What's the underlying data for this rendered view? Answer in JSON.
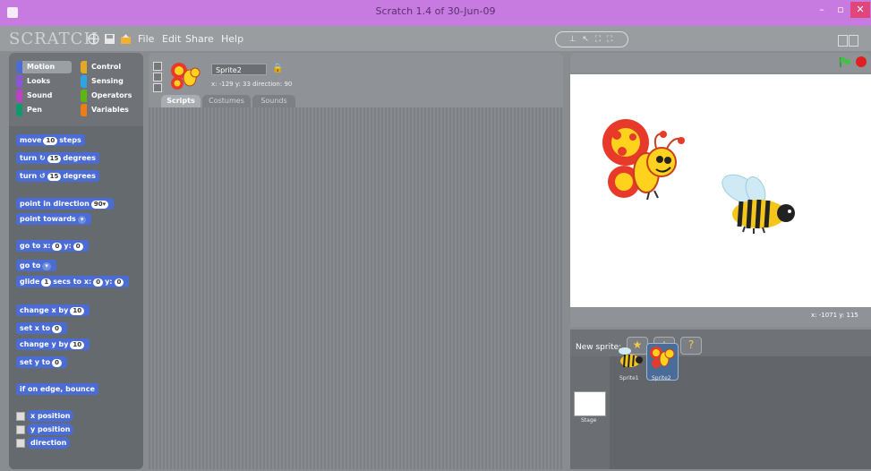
{
  "window": {
    "title": "Scratch 1.4 of 30-Jun-09",
    "controls": [
      "–",
      "▫",
      "✕"
    ]
  },
  "menubar": {
    "logo": "SCRATCH",
    "menus": [
      "File",
      "Edit",
      "Share",
      "Help"
    ],
    "mode_buttons": "⊥ ↖ ⛶ ⛶"
  },
  "categories": [
    {
      "label": "Motion",
      "color": "#4a6cd4",
      "selected": true
    },
    {
      "label": "Control",
      "color": "#e6a822"
    },
    {
      "label": "Looks",
      "color": "#8a55d7"
    },
    {
      "label": "Sensing",
      "color": "#2ca5e2"
    },
    {
      "label": "Sound",
      "color": "#bb42c3"
    },
    {
      "label": "Operators",
      "color": "#5cb712"
    },
    {
      "label": "Pen",
      "color": "#0e9a6c"
    },
    {
      "label": "Variables",
      "color": "#ee7d16"
    }
  ],
  "blocks": {
    "move": {
      "text": "move",
      "val": "10",
      "suffix": "steps"
    },
    "turn_cw": {
      "text": "turn ↻",
      "val": "15",
      "suffix": "degrees"
    },
    "turn_ccw": {
      "text": "turn ↺",
      "val": "15",
      "suffix": "degrees"
    },
    "point_dir": {
      "text": "point in direction",
      "val": "90▾"
    },
    "point_towards": {
      "text": "point towards",
      "val": "▾"
    },
    "goto_xy": {
      "text": "go to x:",
      "x": "0",
      "y_label": "y:",
      "y": "0"
    },
    "goto": {
      "text": "go to",
      "val": "▾"
    },
    "glide": {
      "text": "glide",
      "val": "1",
      "mid": "secs to x:",
      "x": "0",
      "y_label": "y:",
      "y": "0"
    },
    "change_x": {
      "text": "change x by",
      "val": "10"
    },
    "set_x": {
      "text": "set x to",
      "val": "0"
    },
    "change_y": {
      "text": "change y by",
      "val": "10"
    },
    "set_y": {
      "text": "set y to",
      "val": "0"
    },
    "bounce": {
      "text": "if on edge, bounce"
    },
    "x_position": {
      "text": "x position"
    },
    "y_position": {
      "text": "y position"
    },
    "direction": {
      "text": "direction"
    }
  },
  "sprite": {
    "name": "Sprite2",
    "coords": "x: -129  y: 33    direction: 90"
  },
  "tabs": [
    "Scripts",
    "Costumes",
    "Sounds"
  ],
  "stage": {
    "mouse_readout": "x: -1071  y: 115"
  },
  "new_sprite": {
    "label": "New sprite:"
  },
  "sprites": [
    {
      "name": "Sprite1"
    },
    {
      "name": "Sprite2",
      "selected": true
    }
  ],
  "stage_thumb": {
    "label": "Stage"
  }
}
